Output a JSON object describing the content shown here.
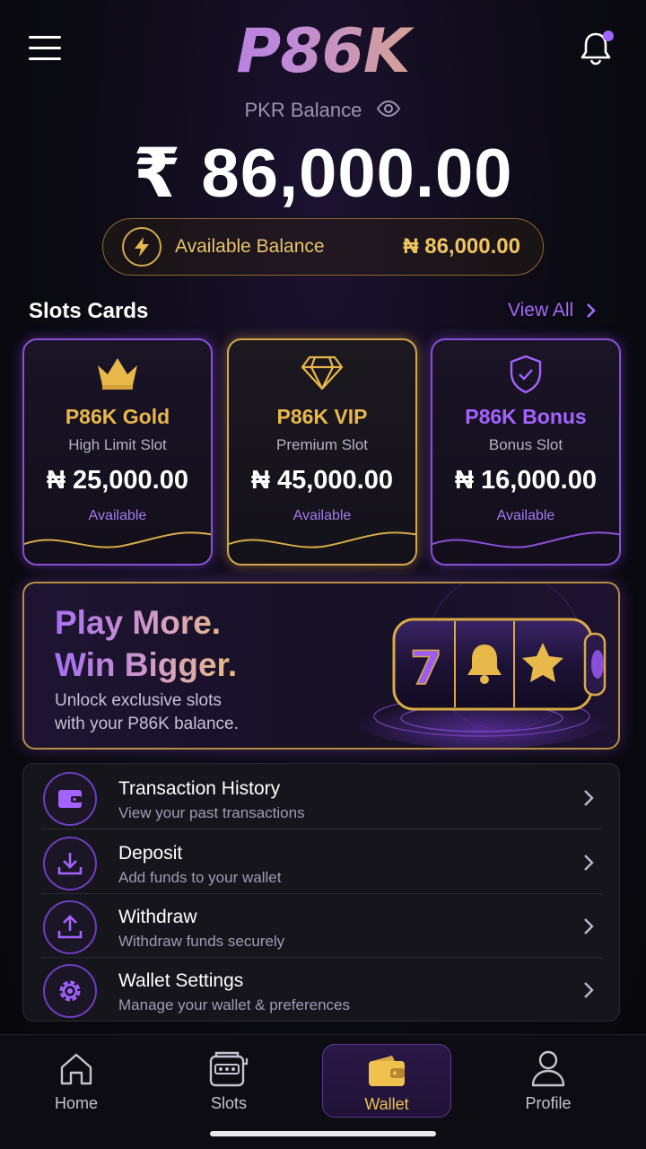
{
  "header": {
    "logo": "P86K",
    "balance_label": "PKR Balance",
    "balance_amount": "₹ 86,000.00",
    "available_label": "Available Balance",
    "available_value": "₦ 86,000.00"
  },
  "slots": {
    "title": "Slots Cards",
    "view_all": "View All",
    "cards": [
      {
        "name": "P86K Gold",
        "sub": "High Limit Slot",
        "value": "₦ 25,000.00",
        "status": "Available",
        "icon": "crown-icon",
        "accent": "#e8b84a"
      },
      {
        "name": "P86K VIP",
        "sub": "Premium Slot",
        "value": "₦ 45,000.00",
        "status": "Available",
        "icon": "diamond-icon",
        "accent": "#e8b84a"
      },
      {
        "name": "P86K Bonus",
        "sub": "Bonus Slot",
        "value": "₦ 16,000.00",
        "status": "Available",
        "icon": "shield-check-icon",
        "accent": "#a463ff"
      }
    ]
  },
  "promo": {
    "line1": "Play More.",
    "line2": "Win Bigger.",
    "sub1": "Unlock exclusive slots",
    "sub2": "with your P86K balance."
  },
  "menu": [
    {
      "title": "Transaction History",
      "sub": "View your past transactions",
      "icon": "wallet-icon"
    },
    {
      "title": "Deposit",
      "sub": "Add funds to your wallet",
      "icon": "download-icon"
    },
    {
      "title": "Withdraw",
      "sub": "Withdraw funds securely",
      "icon": "upload-icon"
    },
    {
      "title": "Wallet Settings",
      "sub": "Manage your wallet & preferences",
      "icon": "gear-icon"
    }
  ],
  "nav": [
    {
      "label": "Home",
      "icon": "home-icon"
    },
    {
      "label": "Slots",
      "icon": "slot-machine-icon"
    },
    {
      "label": "Wallet",
      "icon": "wallet-icon",
      "active": true
    },
    {
      "label": "Profile",
      "icon": "user-icon"
    }
  ],
  "colors": {
    "accent_purple": "#a463ff",
    "accent_gold": "#e8b84a",
    "background": "#0b0a12"
  }
}
